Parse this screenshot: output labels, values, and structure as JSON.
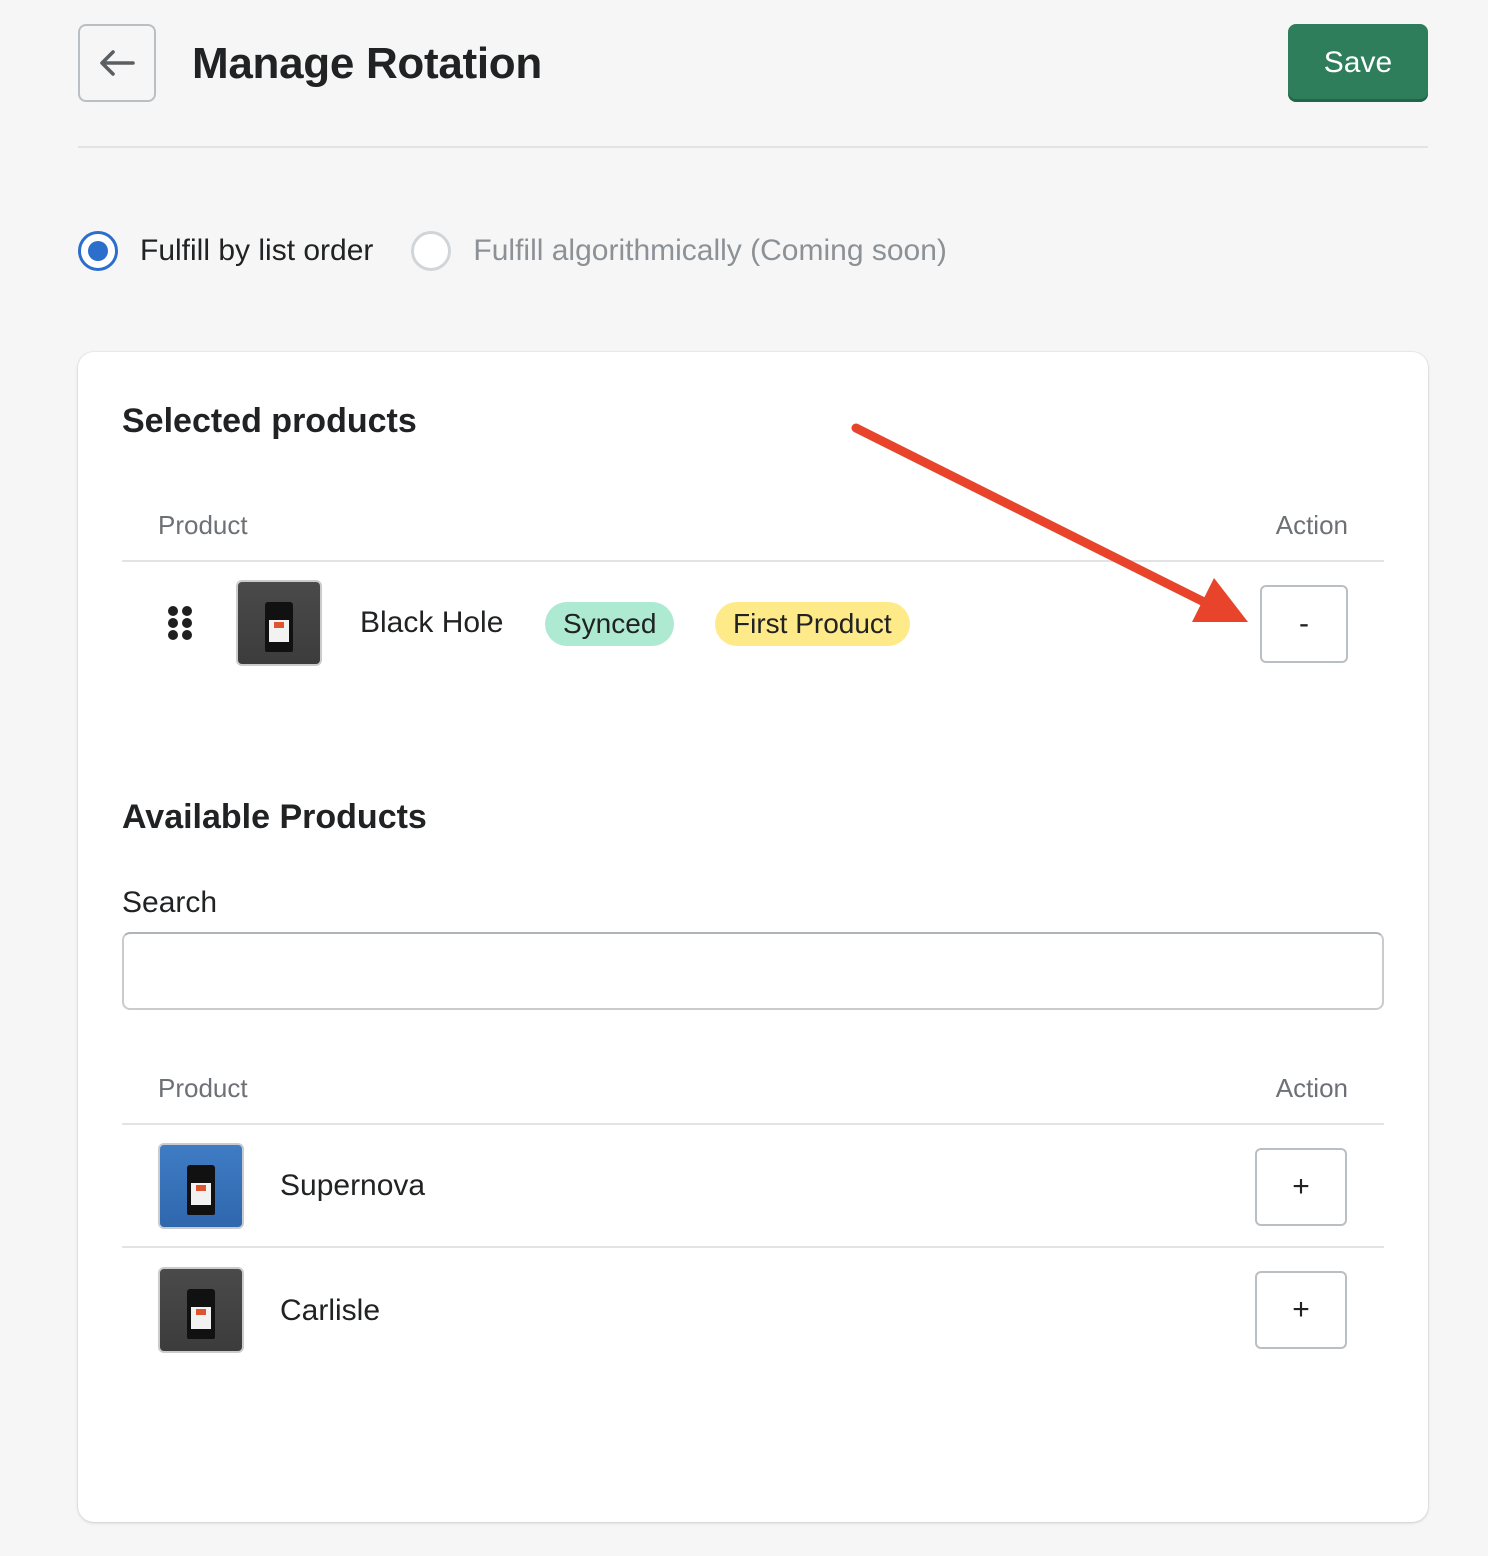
{
  "header": {
    "title": "Manage Rotation",
    "save_label": "Save"
  },
  "fulfillment": {
    "options": [
      {
        "label": "Fulfill by list order",
        "checked": true,
        "disabled": false
      },
      {
        "label": "Fulfill algorithmically (Coming soon)",
        "checked": false,
        "disabled": true
      }
    ]
  },
  "selected": {
    "title": "Selected products",
    "columns": {
      "product": "Product",
      "action": "Action"
    },
    "rows": [
      {
        "name": "Black Hole",
        "badges": [
          "Synced",
          "First Product"
        ],
        "action_label": "-"
      }
    ]
  },
  "available": {
    "title": "Available Products",
    "search_label": "Search",
    "search_value": "",
    "search_placeholder": "",
    "columns": {
      "product": "Product",
      "action": "Action"
    },
    "rows": [
      {
        "name": "Supernova",
        "action_label": "+"
      },
      {
        "name": "Carlisle",
        "action_label": "+"
      }
    ]
  },
  "colors": {
    "primary": "#2e7d5b",
    "radio_checked": "#2c6ecb",
    "badge_synced": "#aee9d1",
    "badge_first": "#ffea8a",
    "annotation_arrow": "#e8432b"
  },
  "icons": {
    "back": "arrow-left-icon",
    "drag": "drag-handle-icon"
  }
}
